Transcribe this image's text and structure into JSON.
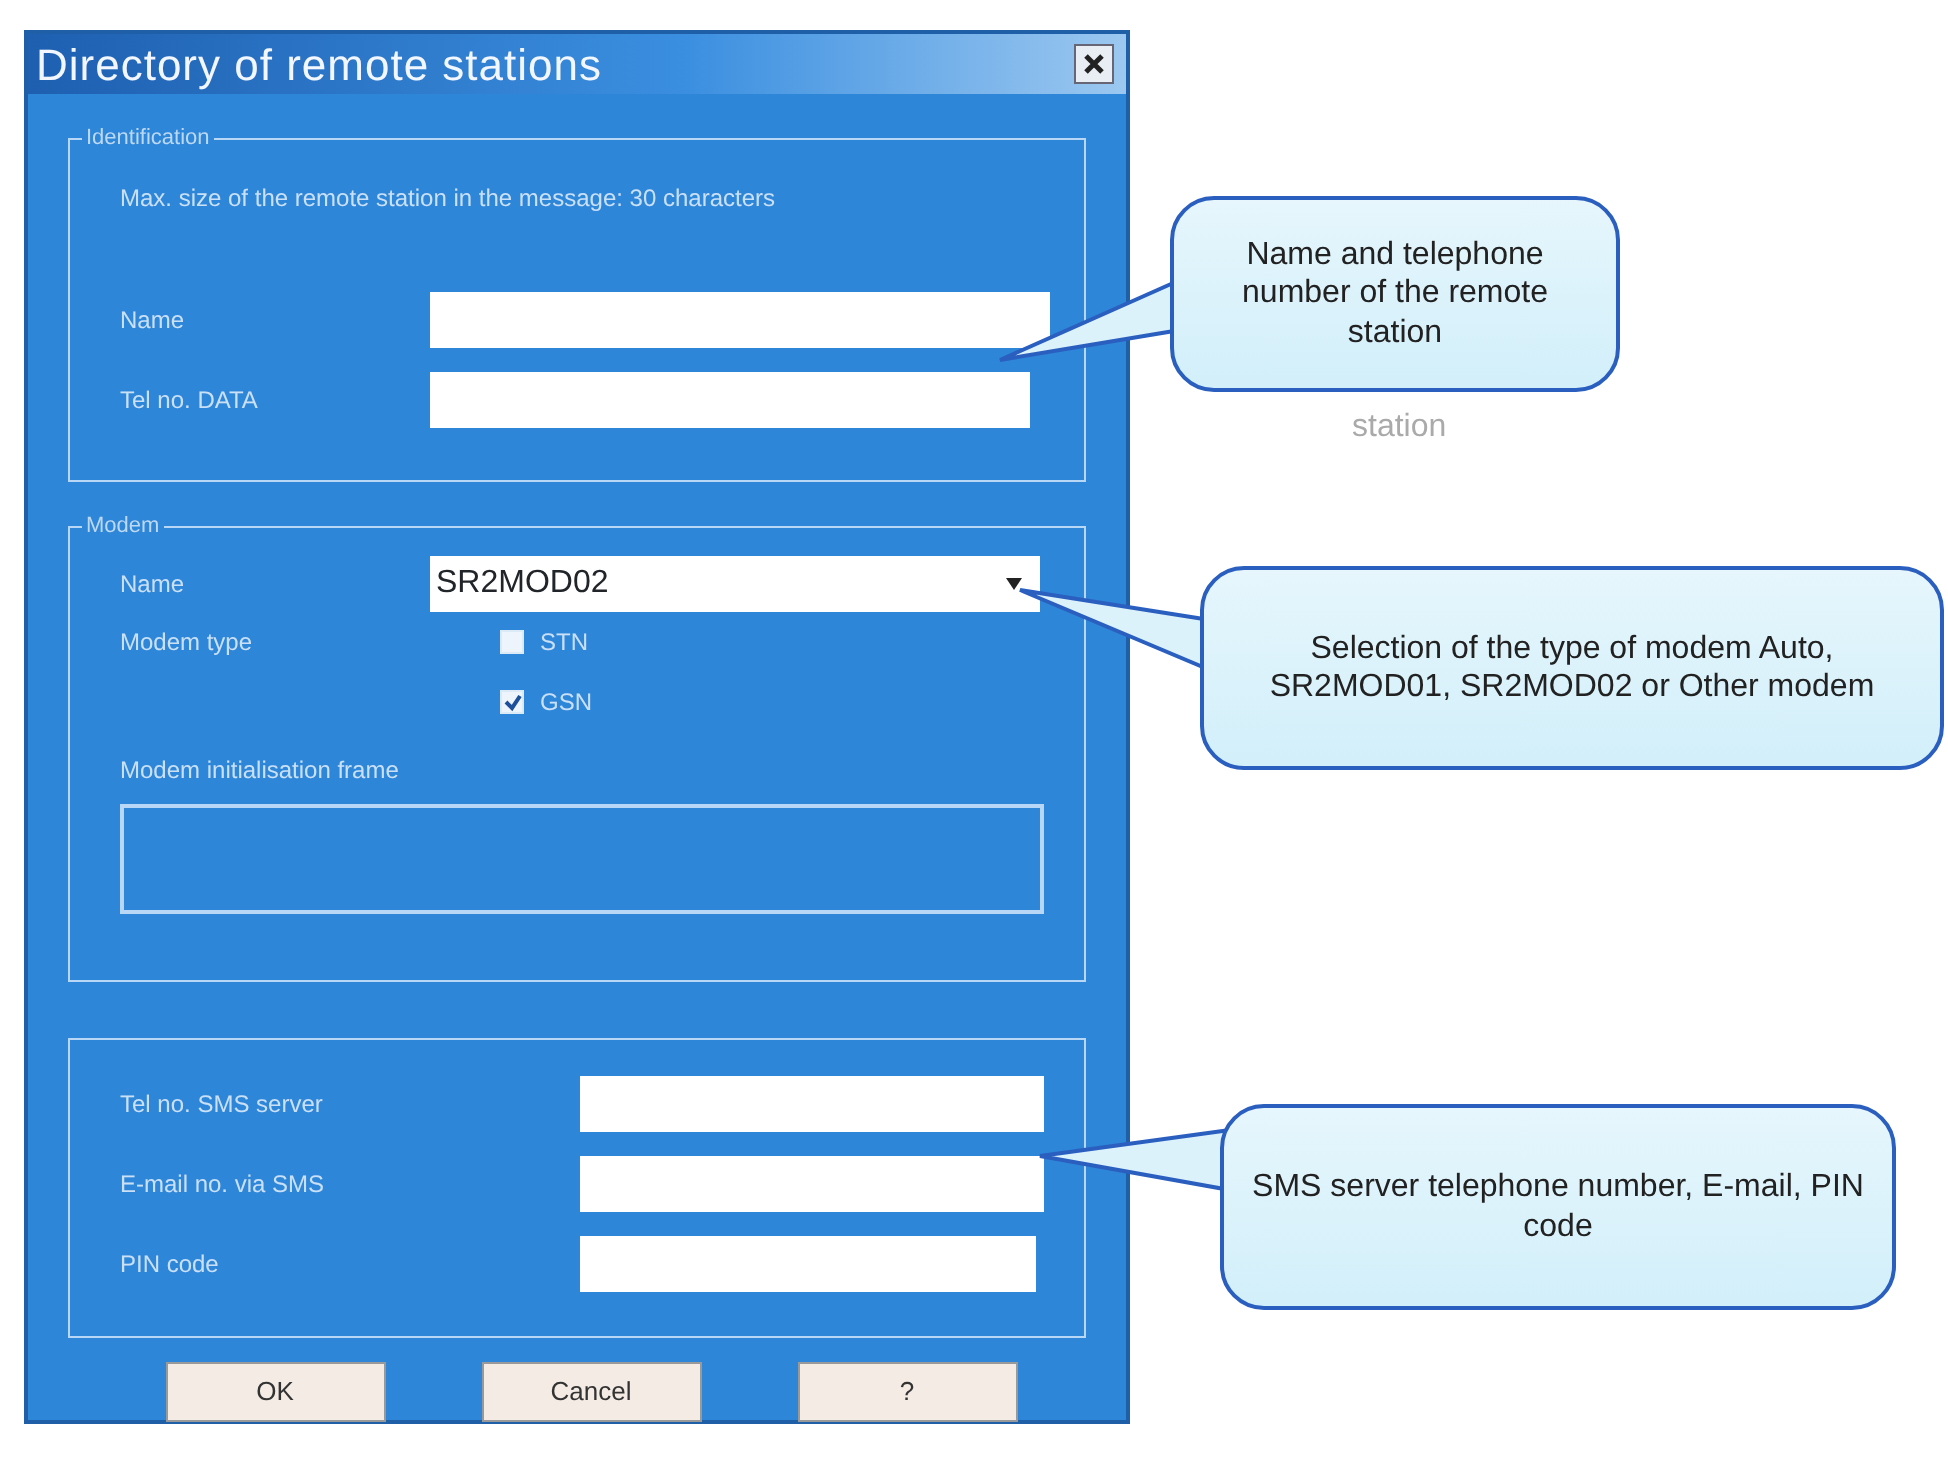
{
  "window": {
    "title": "Directory of remote stations"
  },
  "identification": {
    "legend": "Identification",
    "note": "Max. size of the remote station in the message: 30 characters",
    "fields": [
      {
        "label": "Name"
      },
      {
        "label": "Tel no. DATA"
      }
    ]
  },
  "modem": {
    "legend": "Modem",
    "name_label": "Name",
    "name_value": "SR2MOD02",
    "type_label": "Modem type",
    "types": [
      {
        "label": "STN",
        "selected": false
      },
      {
        "label": "GSN",
        "selected": true
      }
    ],
    "init_label": "Modem initialisation frame"
  },
  "sms": {
    "fields": [
      {
        "label": "Tel no. SMS server"
      },
      {
        "label": "E-mail no. via SMS"
      },
      {
        "label": "PIN code"
      }
    ]
  },
  "buttons": [
    "OK",
    "Cancel",
    "?"
  ],
  "callouts": [
    {
      "text": "Name and telephone number of the remote station"
    },
    {
      "text": "Selection of the type of modem Auto, SR2MOD01, SR2MOD02 or Other modem"
    },
    {
      "text": "SMS server telephone number, E-mail, PIN code"
    }
  ],
  "stray_text": "station"
}
